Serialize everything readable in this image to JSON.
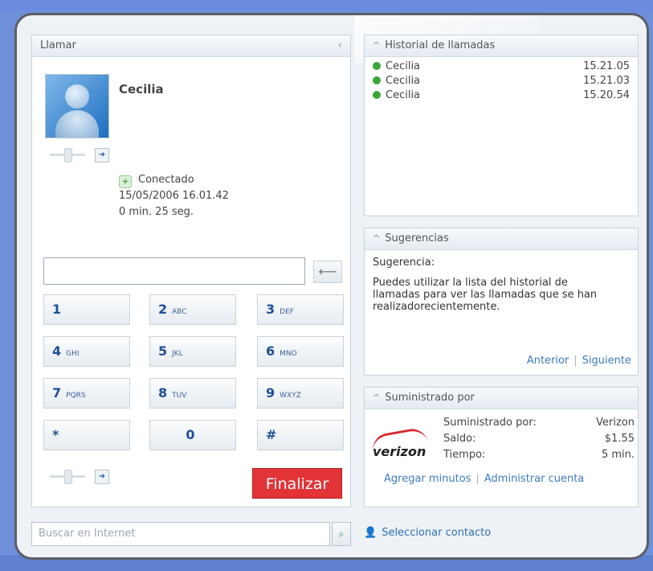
{
  "call_panel": {
    "title": "Llamar",
    "contact_name": "Cecilia",
    "status": "Conectado",
    "datetime": "15/05/2006 16.01.42",
    "duration": "0 min. 25 seg.",
    "keys": [
      {
        "main": "1",
        "sub": ""
      },
      {
        "main": "2",
        "sub": "ABC"
      },
      {
        "main": "3",
        "sub": "DEF"
      },
      {
        "main": "4",
        "sub": "GHI"
      },
      {
        "main": "5",
        "sub": "JKL"
      },
      {
        "main": "6",
        "sub": "MNO"
      },
      {
        "main": "7",
        "sub": "PQRS"
      },
      {
        "main": "8",
        "sub": "TUV"
      },
      {
        "main": "9",
        "sub": "WXYZ"
      },
      {
        "main": "*",
        "sub": ""
      },
      {
        "main": "0",
        "sub": ""
      },
      {
        "main": "#",
        "sub": ""
      }
    ],
    "end_label": "Finalizar"
  },
  "history": {
    "title": "Historial de llamadas",
    "items": [
      {
        "name": "Cecilia",
        "time": "15.21.05"
      },
      {
        "name": "Cecilia",
        "time": "15.21.03"
      },
      {
        "name": "Cecilia",
        "time": "15.20.54"
      }
    ]
  },
  "suggestions": {
    "title": "Sugerencias",
    "heading": "Sugerencia:",
    "text": "Puedes utilizar la lista del historial de llamadas para ver las llamadas que se han realizadorecientemente.",
    "prev": "Anterior",
    "next": "Siguiente"
  },
  "provider": {
    "title": "Suministrado por",
    "logo_text": "verizon",
    "rows": [
      {
        "label": "Suministrado por:",
        "value": "Verizon"
      },
      {
        "label": "Saldo:",
        "value": "$1.55"
      },
      {
        "label": "Tiempo:",
        "value": "5 min."
      }
    ],
    "add_minutes": "Agregar minutos",
    "manage": "Administrar cuenta"
  },
  "bottom": {
    "search_placeholder": "Buscar en Internet",
    "select_contact": "Seleccionar contacto"
  }
}
